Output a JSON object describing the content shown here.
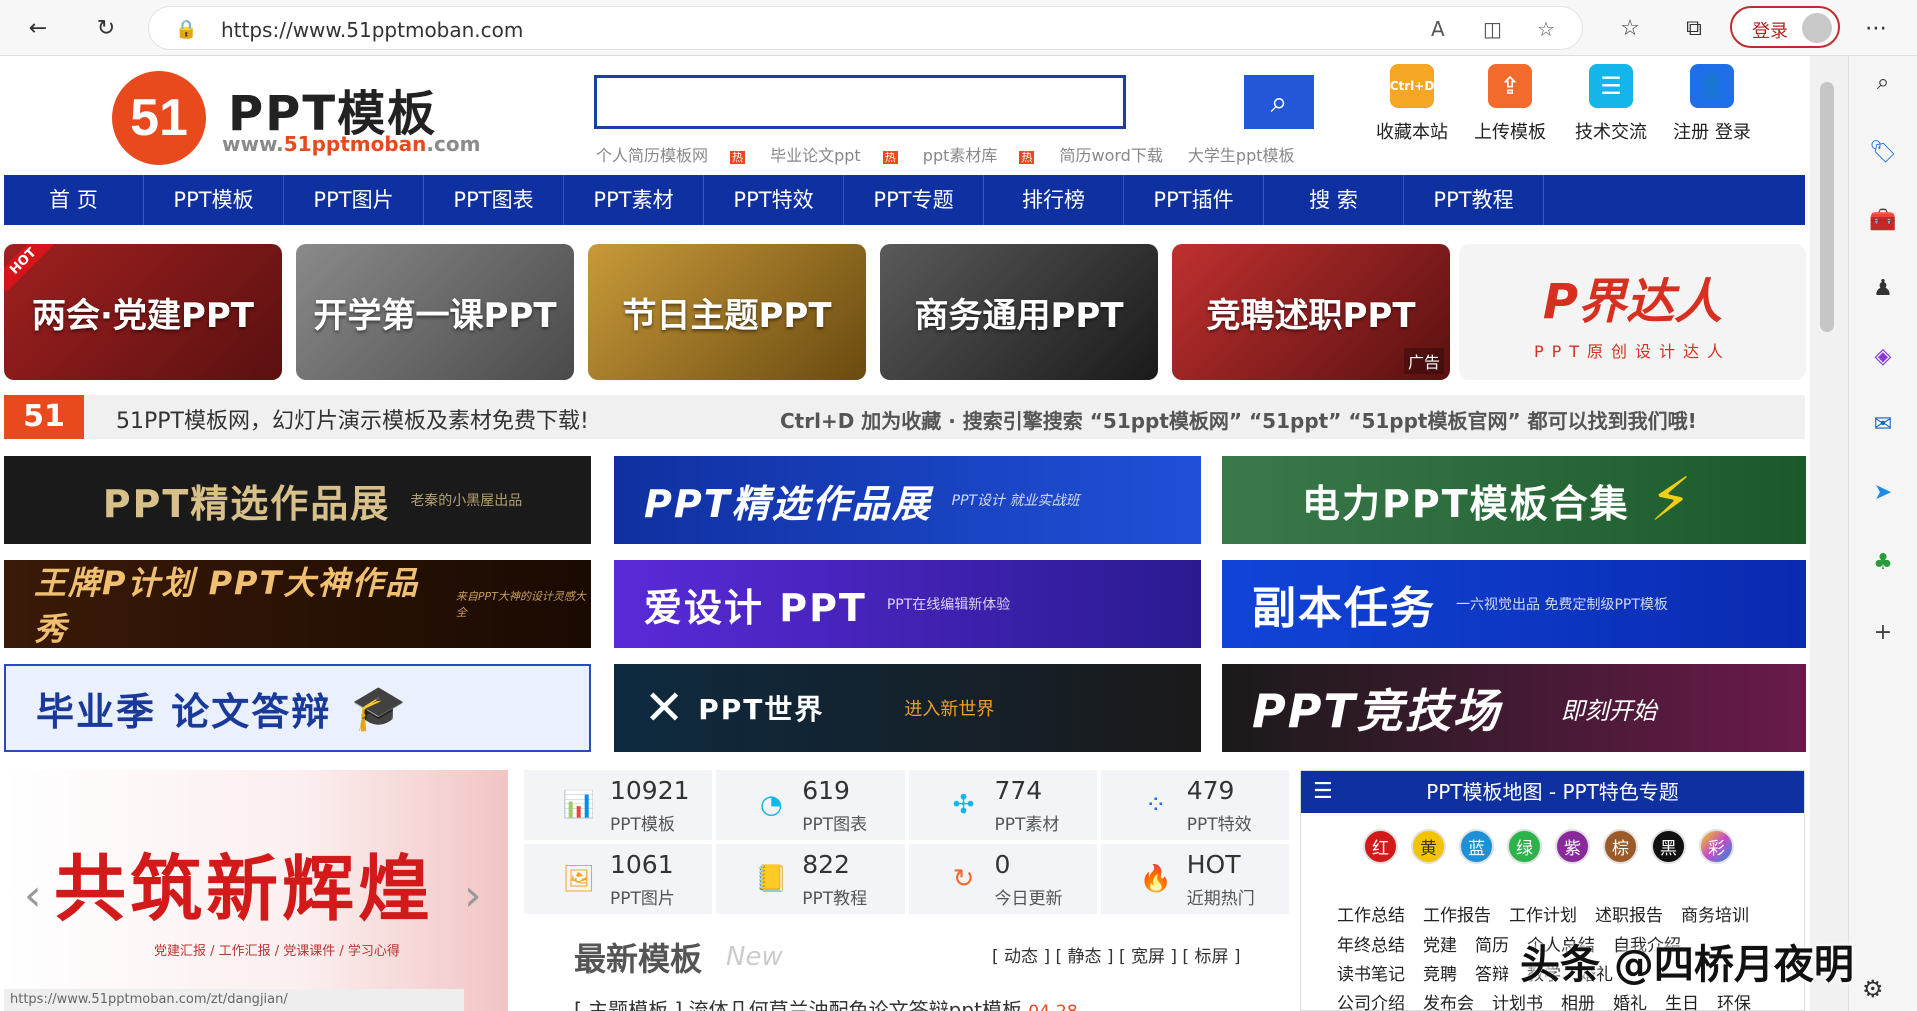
{
  "browser": {
    "url": "https://www.51pptmoban.com",
    "login_label": "登录"
  },
  "site": {
    "logo_mark": "51",
    "logo_title": "PPT模板",
    "logo_domain_prefix": "www.",
    "logo_domain_brand": "51pptmoban",
    "logo_domain_suffix": ".com",
    "hot_words": [
      "个人简历模板网",
      "毕业论文ppt",
      "ppt素材库",
      "简历word下载",
      "大学生ppt模板"
    ],
    "hot_badge": "热",
    "top_icons": [
      {
        "label": "收藏本站",
        "icon": "Ctrl+D",
        "color": "#f5a623"
      },
      {
        "label": "上传模板",
        "icon": "⇪",
        "color": "#f26b2d"
      },
      {
        "label": "技术交流",
        "icon": "☰",
        "color": "#13b5ea"
      },
      {
        "label": "注册 登录",
        "icon": "👤",
        "color": "#1e6fe8"
      }
    ]
  },
  "nav": [
    "首 页",
    "PPT模板",
    "PPT图片",
    "PPT图表",
    "PPT素材",
    "PPT特效",
    "PPT专题",
    "排行榜",
    "PPT插件",
    "搜 索",
    "PPT教程"
  ],
  "categories": [
    {
      "label": "两会·党建PPT",
      "color": "#8b1a1a",
      "hot": "HOT"
    },
    {
      "label": "开学第一课PPT",
      "color": "#6b6b6b"
    },
    {
      "label": "节日主题PPT",
      "color": "#a07a2a"
    },
    {
      "label": "商务通用PPT",
      "color": "#3a3a3a"
    },
    {
      "label": "竞聘述职PPT",
      "color": "#9a2424",
      "ad": "广告"
    },
    {
      "label": "P界达人",
      "color": "#ffffff",
      "sub": "PPT原创设计达人"
    }
  ],
  "strip": {
    "left": "51PPT模板网，幻灯片演示模板及素材免费下载!",
    "right": "Ctrl+D 加为收藏 · 搜索引擎搜索 “51ppt模板网” “51ppt” “51ppt模板官网” 都可以找到我们哦!"
  },
  "banners": [
    {
      "text": "PPT精选作品展",
      "sub": "老秦的小黑屋出品",
      "bg": "#1a1a1a",
      "fg": "#d8c08a"
    },
    {
      "text": "PPT精选作品展",
      "sub": "PPT设计 就业实战班",
      "bg": "#1636a8",
      "fg": "#ffffff"
    },
    {
      "text": "电力PPT模板合集",
      "sub": "",
      "bg": "#1c6a3a",
      "fg": "#ffffff"
    },
    {
      "text": "王牌P计划  PPT大神作品秀",
      "sub": "来自PPT大神的设计灵感大全",
      "bg": "#2a1608",
      "fg": "#f0c070"
    },
    {
      "text": "爱设计 PPT",
      "sub": "PPT在线编辑新体验",
      "bg": "#3a2ab0",
      "fg": "#ffffff"
    },
    {
      "text": "副本任务",
      "sub": "一六视觉出品  免费定制级PPT模板",
      "bg": "#1044d8",
      "fg": "#ffffff"
    },
    {
      "text": "毕业季 论文答辩",
      "sub": "",
      "bg": "#e8eefc",
      "fg": "#1a3a9a"
    },
    {
      "text": "PPT世界",
      "sub": "进入新世界",
      "bg": "#0e2a40",
      "fg": "#ffffff"
    },
    {
      "text": "PPT竞技场",
      "sub": "即刻开始",
      "bg": "#1a1a1a",
      "fg": "#ffffff"
    }
  ],
  "slider": {
    "title": "共筑新辉煌",
    "sub": "党建汇报 / 工作汇报 / 党课课件 / 学习心得",
    "caption": "https://www.51pptmoban.com/zt/dangjian/"
  },
  "stats": [
    {
      "num": "10921",
      "label": "PPT模板",
      "icon": "📊"
    },
    {
      "num": "619",
      "label": "PPT图表",
      "icon": "◔"
    },
    {
      "num": "774",
      "label": "PPT素材",
      "icon": "✣"
    },
    {
      "num": "479",
      "label": "PPT特效",
      "icon": "⁘"
    },
    {
      "num": "1061",
      "label": "PPT图片",
      "icon": "🖼"
    },
    {
      "num": "822",
      "label": "PPT教程",
      "icon": "📒"
    },
    {
      "num": "0",
      "label": "今日更新",
      "icon": "↻"
    },
    {
      "num": "HOT",
      "label": "近期热门",
      "icon": "🔥"
    }
  ],
  "latest": {
    "title": "最新模板",
    "en": "New",
    "filters": "[ 动态 ] [ 静态 ] [ 宽屏 ] [ 标屏 ]",
    "first_item": "[ 主题模板 ] 流体几何草兰油配色论文答辩ppt模板",
    "first_date": "04-28"
  },
  "map": {
    "title": "PPT模板地图 - PPT特色专题",
    "colors": [
      {
        "label": "红",
        "hex": "#d21a1a"
      },
      {
        "label": "黄",
        "hex": "#f2c400"
      },
      {
        "label": "蓝",
        "hex": "#1e90d8"
      },
      {
        "label": "绿",
        "hex": "#2cb34a"
      },
      {
        "label": "紫",
        "hex": "#8a2a9a"
      },
      {
        "label": "棕",
        "hex": "#9a5a2a"
      },
      {
        "label": "黑",
        "hex": "#111111"
      },
      {
        "label": "彩",
        "hex": "#c84ac8"
      }
    ],
    "rows": [
      [
        "工作总结",
        "工作报告",
        "工作计划",
        "述职报告",
        "商务培训"
      ],
      [
        "年终总结",
        "党建",
        "简历",
        "个人总结",
        "自我介绍"
      ],
      [
        "读书笔记",
        "竞聘",
        "答辩",
        "教学",
        "婚礼"
      ],
      [
        "公司介绍",
        "发布会",
        "计划书",
        "相册",
        "婚礼",
        "生日",
        "环保"
      ]
    ]
  },
  "watermark": "头条 @四桥月夜明"
}
